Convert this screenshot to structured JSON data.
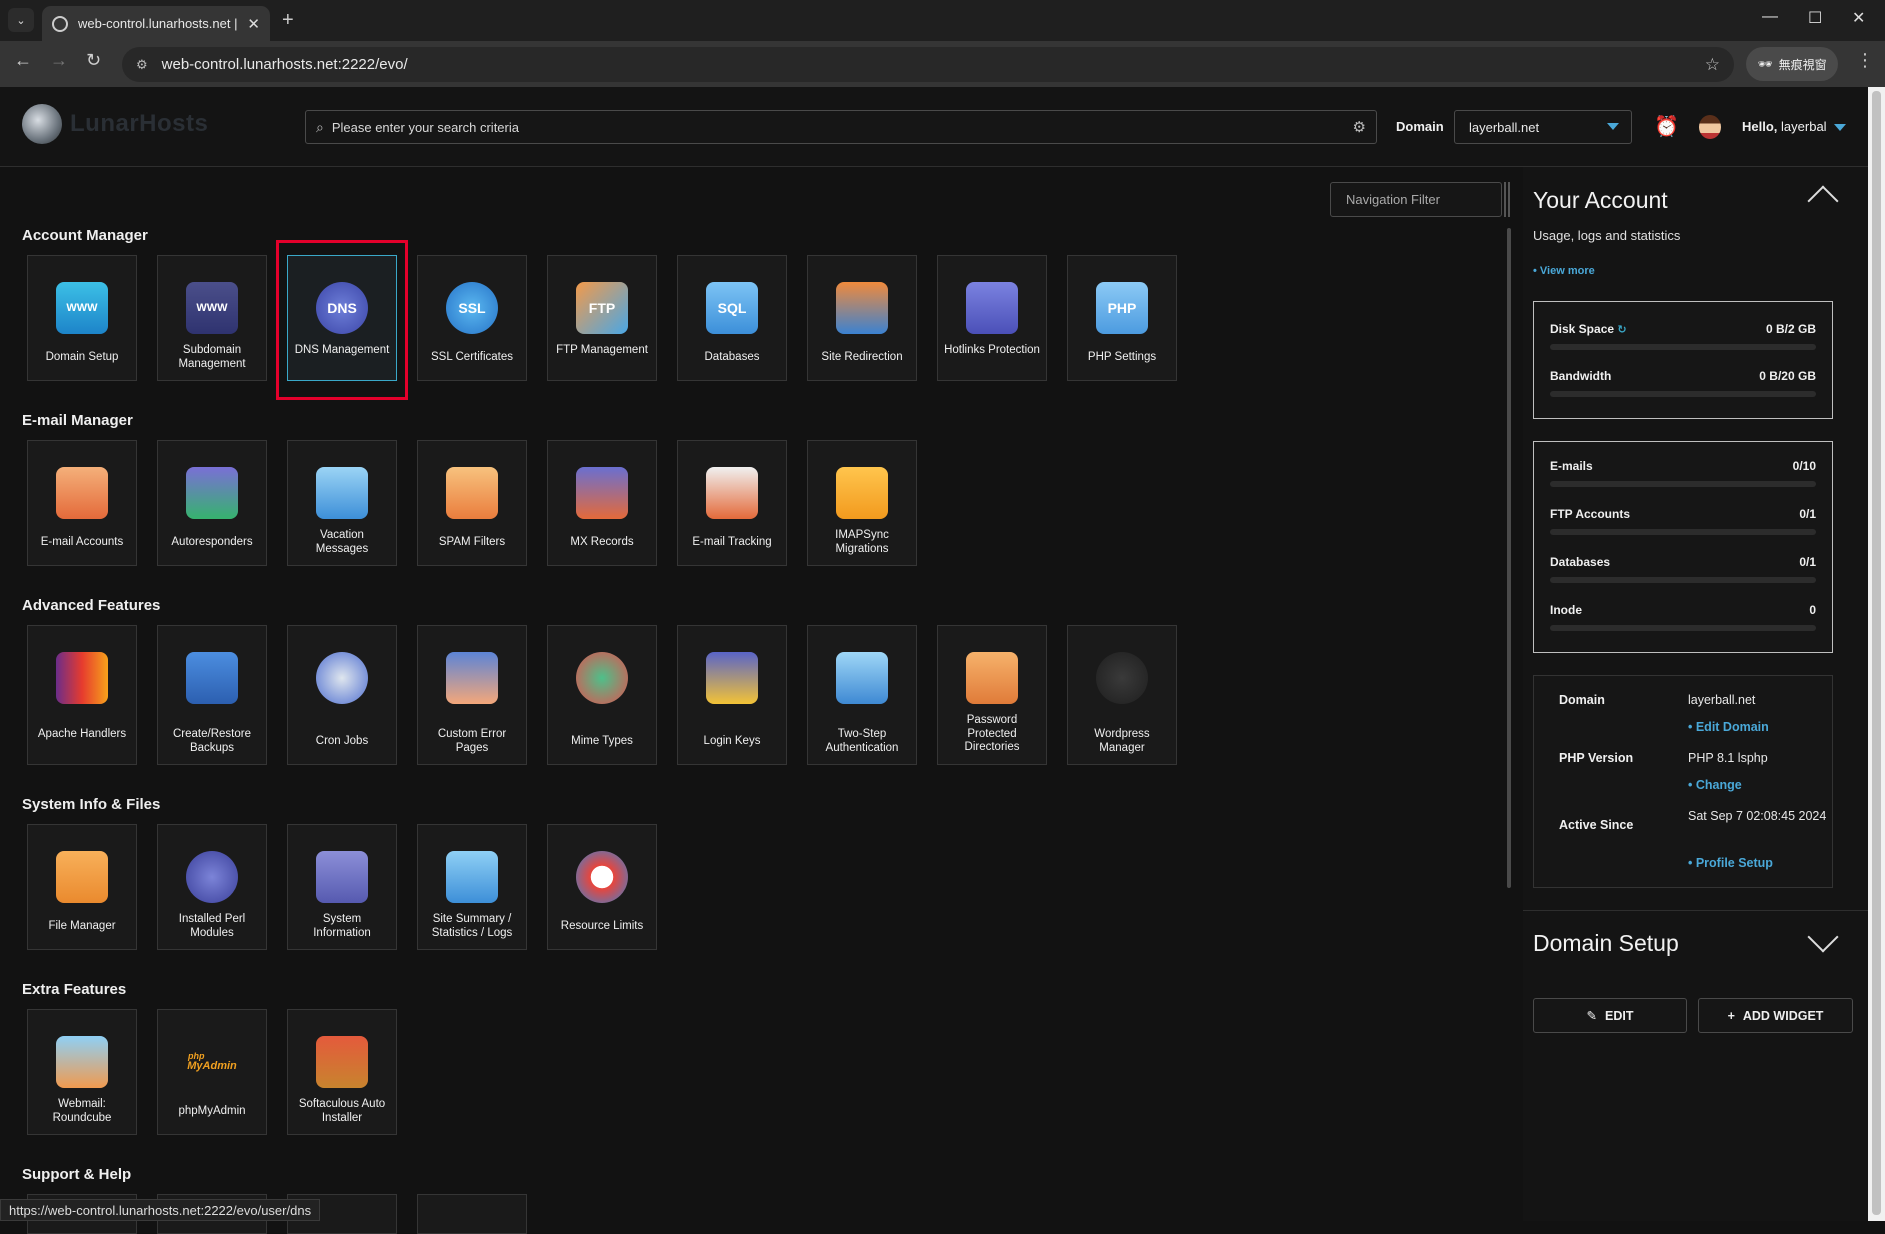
{
  "browser": {
    "tab_title": "web-control.lunarhosts.net | D",
    "url": "web-control.lunarhosts.net:2222/evo/",
    "profile_label": "無痕視窗",
    "status_url": "https://web-control.lunarhosts.net:2222/evo/user/dns"
  },
  "header": {
    "brand": "LunarHosts",
    "search_placeholder": "Please enter your search criteria",
    "domain_label": "Domain",
    "domain_value": "layerball.net",
    "hello_prefix": "Hello,",
    "username": "layerbal"
  },
  "nav_filter_placeholder": "Navigation Filter",
  "sections": [
    {
      "title": "Account Manager",
      "items": [
        "Domain Setup",
        "Subdomain Management",
        "DNS Management",
        "SSL Certificates",
        "FTP Management",
        "Databases",
        "Site Redirection",
        "Hotlinks Protection",
        "PHP Settings"
      ]
    },
    {
      "title": "E-mail Manager",
      "items": [
        "E-mail Accounts",
        "Autoresponders",
        "Vacation Messages",
        "SPAM Filters",
        "MX Records",
        "E-mail Tracking",
        "IMAPSync Migrations"
      ]
    },
    {
      "title": "Advanced Features",
      "items": [
        "Apache Handlers",
        "Create/Restore Backups",
        "Cron Jobs",
        "Custom Error Pages",
        "Mime Types",
        "Login Keys",
        "Two-Step Authentication",
        "Password Protected Directories",
        "Wordpress Manager"
      ]
    },
    {
      "title": "System Info & Files",
      "items": [
        "File Manager",
        "Installed Perl Modules",
        "System Information",
        "Site Summary / Statistics / Logs",
        "Resource Limits"
      ]
    },
    {
      "title": "Extra Features",
      "items": [
        "Webmail: Roundcube",
        "phpMyAdmin",
        "Softaculous Auto Installer"
      ]
    },
    {
      "title": "Support & Help",
      "items": []
    }
  ],
  "icon_texts": {
    "dns": "DNS",
    "ssl": "SSL",
    "ftp": "FTP",
    "sql": "SQL",
    "php": "PHP",
    "www": "WWW",
    "pma_small": "php",
    "pma": "MyAdmin"
  },
  "account": {
    "title": "Your Account",
    "subtitle": "Usage, logs and statistics",
    "view_more": "• View more",
    "usage": [
      {
        "label": "Disk Space",
        "value": "0 B/2 GB"
      },
      {
        "label": "Bandwidth",
        "value": "0 B/20 GB"
      }
    ],
    "limits": [
      {
        "label": "E-mails",
        "value": "0/10"
      },
      {
        "label": "FTP Accounts",
        "value": "0/1"
      },
      {
        "label": "Databases",
        "value": "0/1"
      },
      {
        "label": "Inode",
        "value": "0"
      }
    ],
    "info": {
      "domain_label": "Domain",
      "domain_value": "layerball.net",
      "edit_domain": "• Edit Domain",
      "php_label": "PHP Version",
      "php_value": "PHP 8.1 lsphp",
      "php_change": "• Change",
      "active_label": "Active Since",
      "active_value": "Sat Sep 7 02:08:45 2024",
      "profile_setup": "• Profile Setup"
    }
  },
  "domain_setup_widget": {
    "title": "Domain Setup",
    "edit_label": "EDIT",
    "add_widget_label": "ADD WIDGET"
  }
}
